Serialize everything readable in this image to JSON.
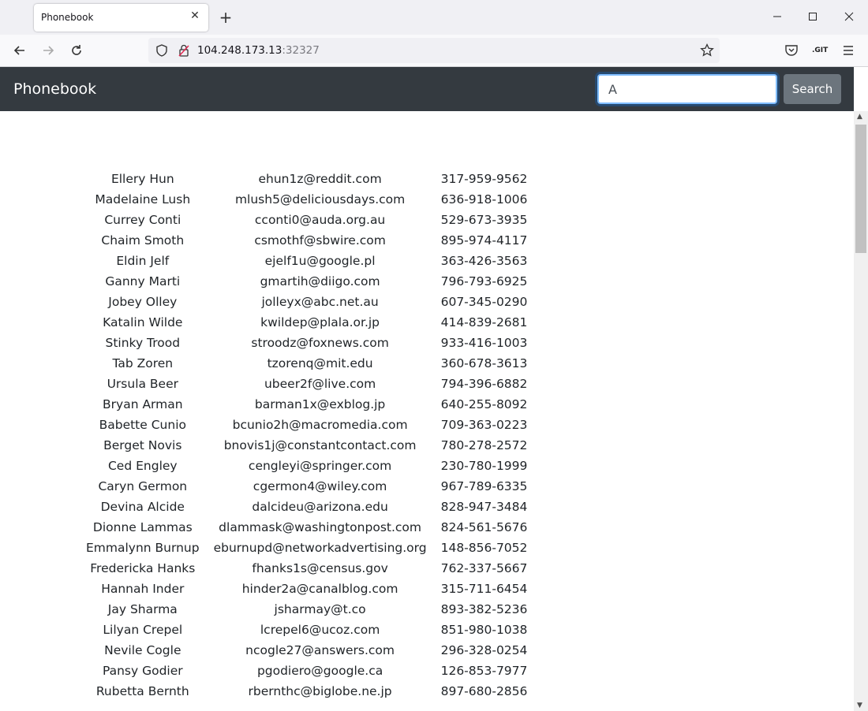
{
  "browser": {
    "tab_title": "Phonebook",
    "url_host": "104.248.173.13",
    "url_port": ":32327"
  },
  "app": {
    "brand": "Phonebook",
    "search_value": "A",
    "search_button": "Search"
  },
  "contacts": [
    {
      "name": "Ellery Hun",
      "email": "ehun1z@reddit.com",
      "phone": "317-959-9562"
    },
    {
      "name": "Madelaine Lush",
      "email": "mlush5@deliciousdays.com",
      "phone": "636-918-1006"
    },
    {
      "name": "Currey Conti",
      "email": "cconti0@auda.org.au",
      "phone": "529-673-3935"
    },
    {
      "name": "Chaim Smoth",
      "email": "csmothf@sbwire.com",
      "phone": "895-974-4117"
    },
    {
      "name": "Eldin Jelf",
      "email": "ejelf1u@google.pl",
      "phone": "363-426-3563"
    },
    {
      "name": "Ganny Marti",
      "email": "gmartih@diigo.com",
      "phone": "796-793-6925"
    },
    {
      "name": "Jobey Olley",
      "email": "jolleyx@abc.net.au",
      "phone": "607-345-0290"
    },
    {
      "name": "Katalin Wilde",
      "email": "kwildep@plala.or.jp",
      "phone": "414-839-2681"
    },
    {
      "name": "Stinky Trood",
      "email": "stroodz@foxnews.com",
      "phone": "933-416-1003"
    },
    {
      "name": "Tab Zoren",
      "email": "tzorenq@mit.edu",
      "phone": "360-678-3613"
    },
    {
      "name": "Ursula Beer",
      "email": "ubeer2f@live.com",
      "phone": "794-396-6882"
    },
    {
      "name": "Bryan Arman",
      "email": "barman1x@exblog.jp",
      "phone": "640-255-8092"
    },
    {
      "name": "Babette Cunio",
      "email": "bcunio2h@macromedia.com",
      "phone": "709-363-0223"
    },
    {
      "name": "Berget Novis",
      "email": "bnovis1j@constantcontact.com",
      "phone": "780-278-2572"
    },
    {
      "name": "Ced Engley",
      "email": "cengleyi@springer.com",
      "phone": "230-780-1999"
    },
    {
      "name": "Caryn Germon",
      "email": "cgermon4@wiley.com",
      "phone": "967-789-6335"
    },
    {
      "name": "Devina Alcide",
      "email": "dalcideu@arizona.edu",
      "phone": "828-947-3484"
    },
    {
      "name": "Dionne Lammas",
      "email": "dlammask@washingtonpost.com",
      "phone": "824-561-5676"
    },
    {
      "name": "Emmalynn Burnup",
      "email": "eburnupd@networkadvertising.org",
      "phone": "148-856-7052"
    },
    {
      "name": "Fredericka Hanks",
      "email": "fhanks1s@census.gov",
      "phone": "762-337-5667"
    },
    {
      "name": "Hannah Inder",
      "email": "hinder2a@canalblog.com",
      "phone": "315-711-6454"
    },
    {
      "name": "Jay Sharma",
      "email": "jsharmay@t.co",
      "phone": "893-382-5236"
    },
    {
      "name": "Lilyan Crepel",
      "email": "lcrepel6@ucoz.com",
      "phone": "851-980-1038"
    },
    {
      "name": "Nevile Cogle",
      "email": "ncogle27@answers.com",
      "phone": "296-328-0254"
    },
    {
      "name": "Pansy Godier",
      "email": "pgodiero@google.ca",
      "phone": "126-853-7977"
    },
    {
      "name": "Rubetta Bernth",
      "email": "rbernthc@biglobe.ne.jp",
      "phone": "897-680-2856"
    }
  ]
}
